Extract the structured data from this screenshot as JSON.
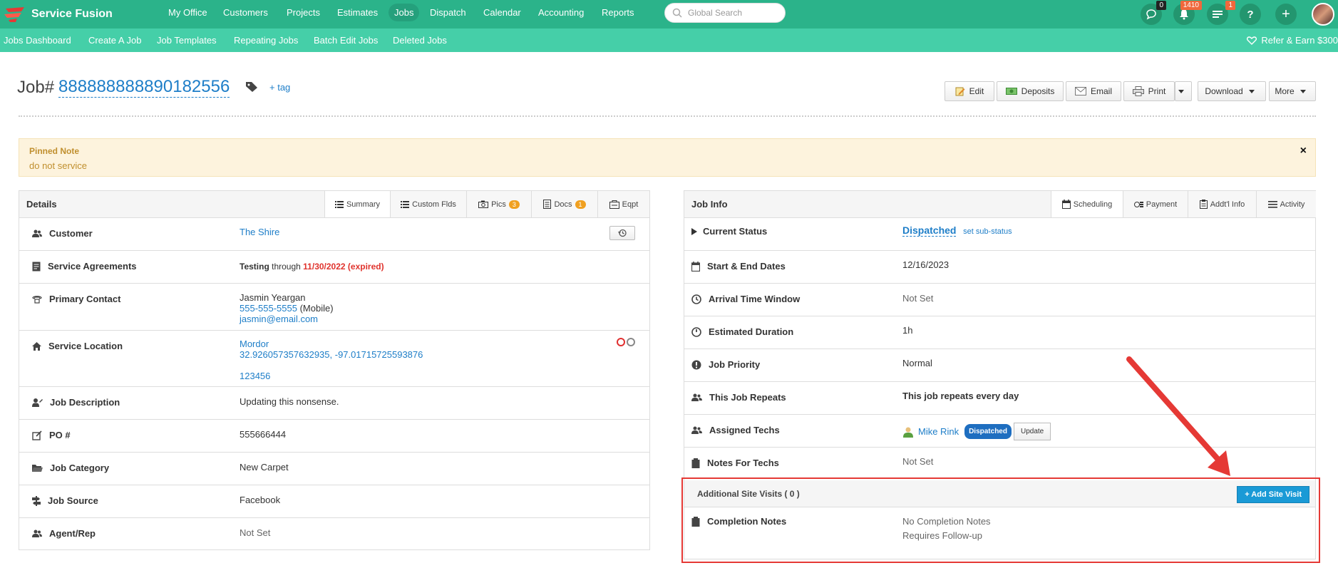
{
  "topnav": {
    "brand": "Service Fusion",
    "items": [
      "My Office",
      "Customers",
      "Projects",
      "Estimates",
      "Jobs",
      "Dispatch",
      "Calendar",
      "Accounting",
      "Reports"
    ],
    "active": "Jobs",
    "search_placeholder": "Global Search",
    "chat_count": "0",
    "notif_count": "1410",
    "tasks_count": "1",
    "help_label": "?",
    "add_label": "+"
  },
  "subnav": {
    "items": [
      "Jobs Dashboard",
      "Create A Job",
      "Job Templates",
      "Repeating Jobs",
      "Batch Edit Jobs",
      "Deleted Jobs"
    ],
    "refer": "Refer & Earn $300"
  },
  "job": {
    "prefix": "Job#",
    "number": "888888888890182556",
    "add_tag": "+ tag"
  },
  "toolbar": {
    "edit": "Edit",
    "deposits": "Deposits",
    "email": "Email",
    "print": "Print",
    "download": "Download",
    "more": "More"
  },
  "pinned": {
    "title": "Pinned Note",
    "body": "do not service",
    "close": "×"
  },
  "details": {
    "title": "Details",
    "tabs": {
      "summary": "Summary",
      "custom": "Custom Flds",
      "pics": "Pics",
      "pics_count": "3",
      "docs": "Docs",
      "docs_count": "1",
      "eqpt": "Eqpt"
    },
    "rows": {
      "customer_label": "Customer",
      "customer_value": "The Shire",
      "agreements_label": "Service Agreements",
      "agreement_name": "Testing",
      "agreement_through": "through",
      "agreement_date": "11/30/2022 (expired)",
      "contact_label": "Primary Contact",
      "contact_name": "Jasmin Yeargan",
      "contact_phone": "555-555-5555",
      "contact_phone_type": "(Mobile)",
      "contact_email": "jasmin@email.com",
      "location_label": "Service Location",
      "location_name": "Mordor",
      "location_coords": "32.926057357632935, -97.01715725593876",
      "location_zip": "123456",
      "description_label": "Job Description",
      "description_value": "Updating this nonsense.",
      "po_label": "PO #",
      "po_value": "555666444",
      "category_label": "Job Category",
      "category_value": "New Carpet",
      "source_label": "Job Source",
      "source_value": "Facebook",
      "agent_label": "Agent/Rep",
      "agent_value": "Not Set"
    }
  },
  "jobinfo": {
    "title": "Job Info",
    "tabs": {
      "scheduling": "Scheduling",
      "payment": "Payment",
      "addl": "Addt'l Info",
      "activity": "Activity"
    },
    "rows": {
      "status_label": "Current Status",
      "status_value": "Dispatched",
      "substatus": "set sub-status",
      "dates_label": "Start & End Dates",
      "dates_value": "12/16/2023",
      "arrival_label": "Arrival Time Window",
      "arrival_value": "Not Set",
      "duration_label": "Estimated Duration",
      "duration_value": "1h",
      "priority_label": "Job Priority",
      "priority_value": "Normal",
      "repeats_label": "This Job Repeats",
      "repeats_value": "This job repeats every day",
      "techs_label": "Assigned Techs",
      "tech_name": "Mike Rink",
      "tech_status": "Dispatched",
      "tech_update": "Update",
      "notes_label": "Notes For Techs",
      "notes_value": "Not Set"
    },
    "visits": {
      "title": "Additional Site Visits ( 0 )",
      "add_button": "Add Site Visit"
    },
    "completion": {
      "label": "Completion Notes",
      "value": "No Completion Notes",
      "followup": "Requires Follow-up"
    }
  }
}
